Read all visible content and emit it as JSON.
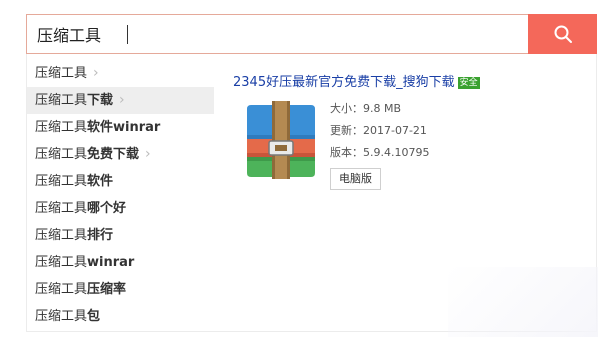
{
  "search": {
    "value": "压缩工具",
    "button_icon": "search-icon"
  },
  "suggestions": [
    {
      "base": "压缩工具",
      "rest": "",
      "has_chevron": true
    },
    {
      "base": "压缩工具",
      "rest": "下载",
      "has_chevron": true
    },
    {
      "base": "压缩工具",
      "rest": "软件winrar",
      "has_chevron": false
    },
    {
      "base": "压缩工具",
      "rest": "免费下载",
      "has_chevron": true
    },
    {
      "base": "压缩工具",
      "rest": "软件",
      "has_chevron": false
    },
    {
      "base": "压缩工具",
      "rest": "哪个好",
      "has_chevron": false
    },
    {
      "base": "压缩工具",
      "rest": "排行",
      "has_chevron": false
    },
    {
      "base": "压缩工具",
      "rest": "winrar",
      "has_chevron": false
    },
    {
      "base": "压缩工具",
      "rest": "压缩率",
      "has_chevron": false
    },
    {
      "base": "压缩工具",
      "rest": "包",
      "has_chevron": false
    }
  ],
  "result": {
    "title": "2345好压最新官方免费下载_搜狗下载",
    "badge": "安全",
    "size": "大小：9.8 MB",
    "updated": "更新：2017-07-21",
    "version": "版本：5.9.4.10795",
    "pc_button": "电脑版"
  },
  "colors": {
    "accent": "#f4685a",
    "link": "#1a3fa6",
    "badge": "#3aa12f"
  }
}
